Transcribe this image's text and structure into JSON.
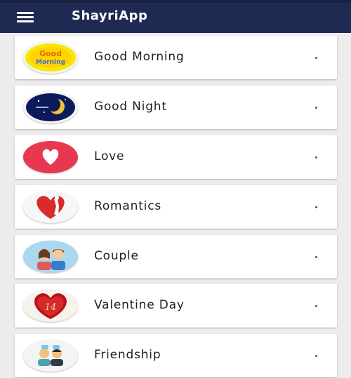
{
  "app": {
    "title": "ShayriApp"
  },
  "items": [
    {
      "label": "Good Morning",
      "icon": "good-morning-sun-icon"
    },
    {
      "label": "Good Night",
      "icon": "moon-night-icon"
    },
    {
      "label": "Love",
      "icon": "heart-icon"
    },
    {
      "label": "Romantics",
      "icon": "romantic-heart-icon"
    },
    {
      "label": "Couple",
      "icon": "couple-avatar-icon"
    },
    {
      "label": "Valentine Day",
      "icon": "valentine-heart-icon"
    },
    {
      "label": "Friendship",
      "icon": "friends-icon"
    }
  ],
  "colors": {
    "appbar": "#1e2a52",
    "love_red": "#e8384f",
    "sun_yellow": "#f5d000"
  }
}
